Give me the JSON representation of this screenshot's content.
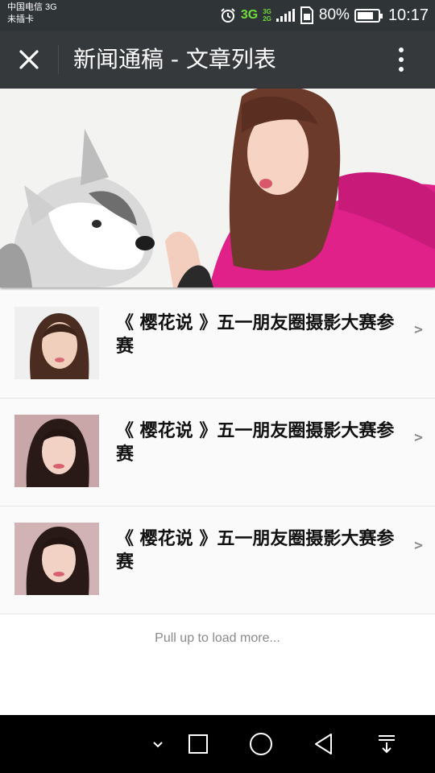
{
  "status_bar": {
    "carrier": "中国电信 3G",
    "sim": "未插卡",
    "network_main": "3G",
    "network_small_top": "3G",
    "network_small_bottom": "2G",
    "battery_percent": "80%",
    "battery_level": 0.8,
    "time": "10:17",
    "icons": [
      "alarm-icon",
      "signal-icon",
      "sim-card-icon",
      "battery-icon"
    ]
  },
  "title_bar": {
    "title": "新闻通稿 - 文章列表",
    "close_icon": "close-icon",
    "more_icon": "more-vertical-icon"
  },
  "banner": {
    "image": "banner-image"
  },
  "articles": [
    {
      "title": "《 樱花说 》五一朋友圈摄影大赛参赛",
      "chevron": ">"
    },
    {
      "title": "《 樱花说 》五一朋友圈摄影大赛参赛",
      "chevron": ">"
    },
    {
      "title": "《 樱花说 》五一朋友圈摄影大赛参赛",
      "chevron": ">"
    }
  ],
  "footer": {
    "load_more": "Pull up to load more..."
  },
  "nav_bar": {
    "icons": [
      "collapse-icon",
      "recent-apps-icon",
      "home-icon",
      "back-icon",
      "notification-pulldown-icon"
    ]
  },
  "colors": {
    "status_bar": "#2f3437",
    "title_bar": "#35393b",
    "network_green": "#6fdc3a",
    "list_bg": "#fafafa"
  }
}
